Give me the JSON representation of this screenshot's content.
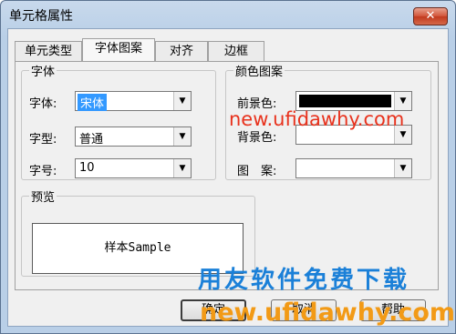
{
  "window": {
    "title": "单元格属性",
    "close_glyph": "✕"
  },
  "tabs": [
    "单元类型",
    "字体图案",
    "对齐",
    "边框"
  ],
  "font_group": {
    "legend": "字体",
    "font_label": "字体:",
    "font_value": "宋体",
    "style_label": "字型:",
    "style_value": "普通",
    "size_label": "字号:",
    "size_value": "10"
  },
  "color_group": {
    "legend": "颜色图案",
    "fg_label": "前景色:",
    "fg_color": "#000000",
    "bg_label": "背景色:",
    "bg_color": "#ffffff",
    "pattern_label": "图　案:",
    "pattern_color": "#ffffff"
  },
  "preview_group": {
    "legend": "预览",
    "sample_text": "样本Sample"
  },
  "buttons": {
    "ok": "确定",
    "cancel": "取消",
    "help": "帮助"
  },
  "watermarks": {
    "red": "new.ufidawhy.com",
    "blue": "用友软件免费下载",
    "orange": "new.ufidawhy.com"
  },
  "dropdown_glyph": "▼"
}
